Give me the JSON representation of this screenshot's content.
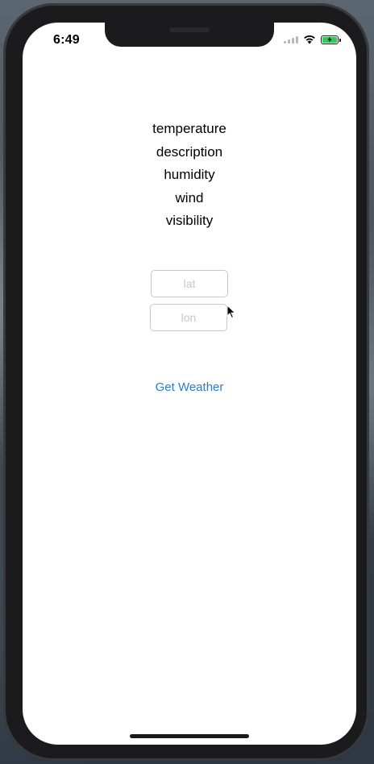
{
  "status_bar": {
    "time": "6:49"
  },
  "weather": {
    "temperature": "temperature",
    "description": "description",
    "humidity": "humidity",
    "wind": "wind",
    "visibility": "visibility"
  },
  "inputs": {
    "lat": {
      "value": "",
      "placeholder": "lat"
    },
    "lon": {
      "value": "",
      "placeholder": "lon"
    }
  },
  "actions": {
    "get_weather_label": "Get Weather"
  },
  "colors": {
    "link_blue": "#2a7bd6",
    "battery_green": "#34c759"
  },
  "icons": [
    "signal-icon",
    "wifi-icon",
    "battery-icon",
    "charging-bolt-icon",
    "cursor-icon"
  ]
}
